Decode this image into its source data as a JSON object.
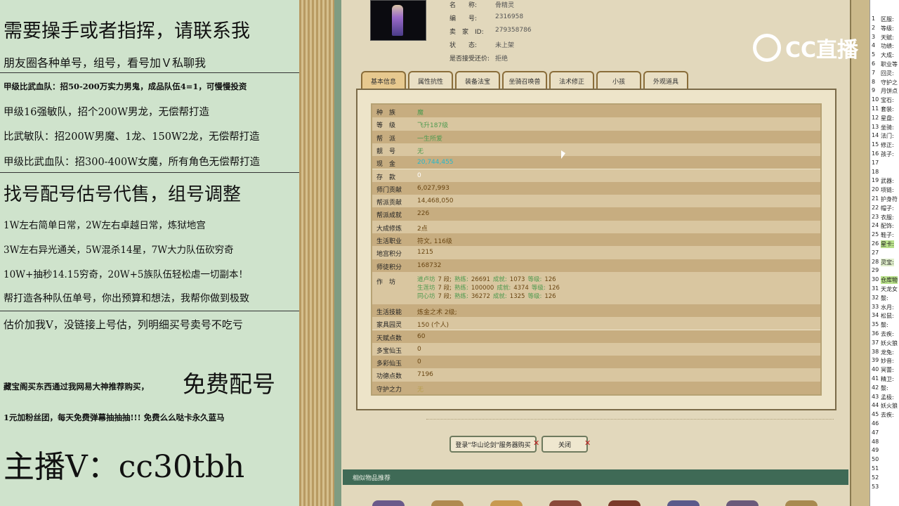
{
  "left_panel": {
    "lines": [
      "需要操手或者指挥，请联系我",
      "朋友圈各种单号，组号，看号加Ｖ私聊我",
      "甲级比武血队：招50-200万实力男鬼，成品队伍4=1，可慢慢投资",
      "甲级16强敏队，招个200W男龙，无偿帮打造",
      "比武敏队：招200W男魔、1龙、150W2龙，无偿帮打造",
      "甲级比武血队：招300-400W女魔，所有角色无偿帮打造",
      "找号配号估号代售，组号调整",
      "1W左右简单日常，2W左右卓越日常，炼狱地宫",
      "3W左右异光通关，5W混杀14星，7W大力队伍砍穷奇",
      "10W+抽秒14.15穷奇，20W+5族队伍轻松虐一切副本！",
      "帮打造各种队伍单号，你出预算和想法，我帮你做到极致",
      "估价加我V，没链接上号估，列明细买号卖号不吃亏",
      "藏宝阁买东西通过我网易大神推荐购买，",
      "免费配号",
      "1元加粉丝团，每天免费弹幕抽抽抽!!! 免费么么哒卡永久蓝马",
      "主播V：cc30tbh"
    ]
  },
  "character": {
    "fields": [
      {
        "label": "名　　称:",
        "value": "骨精灵"
      },
      {
        "label": "编　　号:",
        "value": "2316958"
      },
      {
        "label": "卖　家　ID:",
        "value": "279358786"
      },
      {
        "label": "状　　态:",
        "value": "未上架"
      },
      {
        "label": "是否接受还价:",
        "value": "拒绝"
      }
    ]
  },
  "tabs": [
    "基本信息",
    "属性抗性",
    "装备法宝",
    "坐骑召唤兽",
    "法术修正",
    "小孩",
    "外观道具"
  ],
  "basic_info": [
    {
      "label": "种　族",
      "value": "魔"
    },
    {
      "label": "等　级",
      "value": "飞升187级"
    },
    {
      "label": "帮　派",
      "value": "一生所爱"
    },
    {
      "label": "靓　号",
      "value": "无"
    },
    {
      "label": "现　金",
      "value": "20,744,455"
    },
    {
      "label": "存　款",
      "value": "0"
    },
    {
      "label": "师门贡献",
      "value": "6,027,993"
    },
    {
      "label": "帮派贡献",
      "value": "14,468,050"
    },
    {
      "label": "帮派成就",
      "value": "226"
    },
    {
      "label": "大成修炼",
      "value": "2点"
    },
    {
      "label": "生活职业",
      "value": "符文, 116级"
    },
    {
      "label": "地宫积分",
      "value": "1215"
    },
    {
      "label": "师徒积分",
      "value": "168732"
    },
    {
      "label": "作　坊",
      "value": ""
    },
    {
      "label": "生活技能",
      "value": "炼金之术 2级;"
    },
    {
      "label": "家具园灵",
      "value": "150 (个人)"
    },
    {
      "label": "天赋点数",
      "value": "60"
    },
    {
      "label": "多宝仙玉",
      "value": "0"
    },
    {
      "label": "多彩仙玉",
      "value": "0"
    },
    {
      "label": "功德点数",
      "value": "7196"
    },
    {
      "label": "守护之力",
      "value": "无"
    }
  ],
  "workshop": [
    {
      "name": "道卢坊",
      "level": "7 段;",
      "k1": "熟练:",
      "v1": "26691",
      "k2": "成就:",
      "v2": "1073",
      "k3": "等级:",
      "v3": "126"
    },
    {
      "name": "生莲坊",
      "level": "7 段;",
      "k1": "熟练:",
      "v1": "100000",
      "k2": "成就:",
      "v2": "4374",
      "k3": "等级:",
      "v3": "126"
    },
    {
      "name": "同心坊",
      "level": "7 段;",
      "k1": "熟练:",
      "v1": "36272",
      "k2": "成就:",
      "v2": "1325",
      "k3": "等级:",
      "v3": "126"
    }
  ],
  "buttons": {
    "login": "登录\"华山论剑\"服务器购买",
    "close": "关闭"
  },
  "similar_bar": "相似物品推荐",
  "logo": "CC直播",
  "spreadsheet": {
    "rows": [
      {
        "n": "1",
        "t": "区服:"
      },
      {
        "n": "2",
        "t": "等级:"
      },
      {
        "n": "3",
        "t": "天赋:"
      },
      {
        "n": "4",
        "t": "功绩:"
      },
      {
        "n": "5",
        "t": "大成:"
      },
      {
        "n": "6",
        "t": "职业等"
      },
      {
        "n": "7",
        "t": "回灵:"
      },
      {
        "n": "8",
        "t": "守护之"
      },
      {
        "n": "9",
        "t": "月饼点"
      },
      {
        "n": "10",
        "t": "宝石:"
      },
      {
        "n": "11",
        "t": "套装:"
      },
      {
        "n": "12",
        "t": "星盘:"
      },
      {
        "n": "13",
        "t": "坐骑:"
      },
      {
        "n": "14",
        "t": "法门:"
      },
      {
        "n": "15",
        "t": "修正:"
      },
      {
        "n": "16",
        "t": "孩子:"
      },
      {
        "n": "17",
        "t": ""
      },
      {
        "n": "18",
        "t": ""
      },
      {
        "n": "19",
        "t": "武器:"
      },
      {
        "n": "20",
        "t": "项链:"
      },
      {
        "n": "21",
        "t": "护身符"
      },
      {
        "n": "22",
        "t": "帽子:"
      },
      {
        "n": "23",
        "t": "衣服:"
      },
      {
        "n": "24",
        "t": "配饰:"
      },
      {
        "n": "25",
        "t": "鞋子:"
      },
      {
        "n": "26",
        "t": "星卡:"
      },
      {
        "n": "27",
        "t": ""
      },
      {
        "n": "28",
        "t": "灵宝:"
      },
      {
        "n": "29",
        "t": ""
      },
      {
        "n": "30",
        "t": "仓库物"
      },
      {
        "n": "31",
        "t": "天龙女"
      },
      {
        "n": "32",
        "t": "鬃:"
      },
      {
        "n": "33",
        "t": "水月:"
      },
      {
        "n": "34",
        "t": "松鼠:"
      },
      {
        "n": "35",
        "t": "鬃:"
      },
      {
        "n": "36",
        "t": "去疾:"
      },
      {
        "n": "37",
        "t": "妖火狼"
      },
      {
        "n": "38",
        "t": "龙兔:"
      },
      {
        "n": "39",
        "t": "妙音:"
      },
      {
        "n": "40",
        "t": "冥蕾:"
      },
      {
        "n": "41",
        "t": "精卫:"
      },
      {
        "n": "42",
        "t": "鬃:"
      },
      {
        "n": "43",
        "t": "孟极:"
      },
      {
        "n": "44",
        "t": "妖火狼"
      },
      {
        "n": "45",
        "t": "去疾:"
      },
      {
        "n": "46",
        "t": ""
      },
      {
        "n": "47",
        "t": ""
      },
      {
        "n": "48",
        "t": ""
      },
      {
        "n": "49",
        "t": ""
      },
      {
        "n": "50",
        "t": ""
      },
      {
        "n": "51",
        "t": ""
      },
      {
        "n": "52",
        "t": ""
      },
      {
        "n": "53",
        "t": ""
      }
    ]
  },
  "colors": {
    "accent_green": "#3f6a56",
    "tab_active": "#e7c98f"
  }
}
